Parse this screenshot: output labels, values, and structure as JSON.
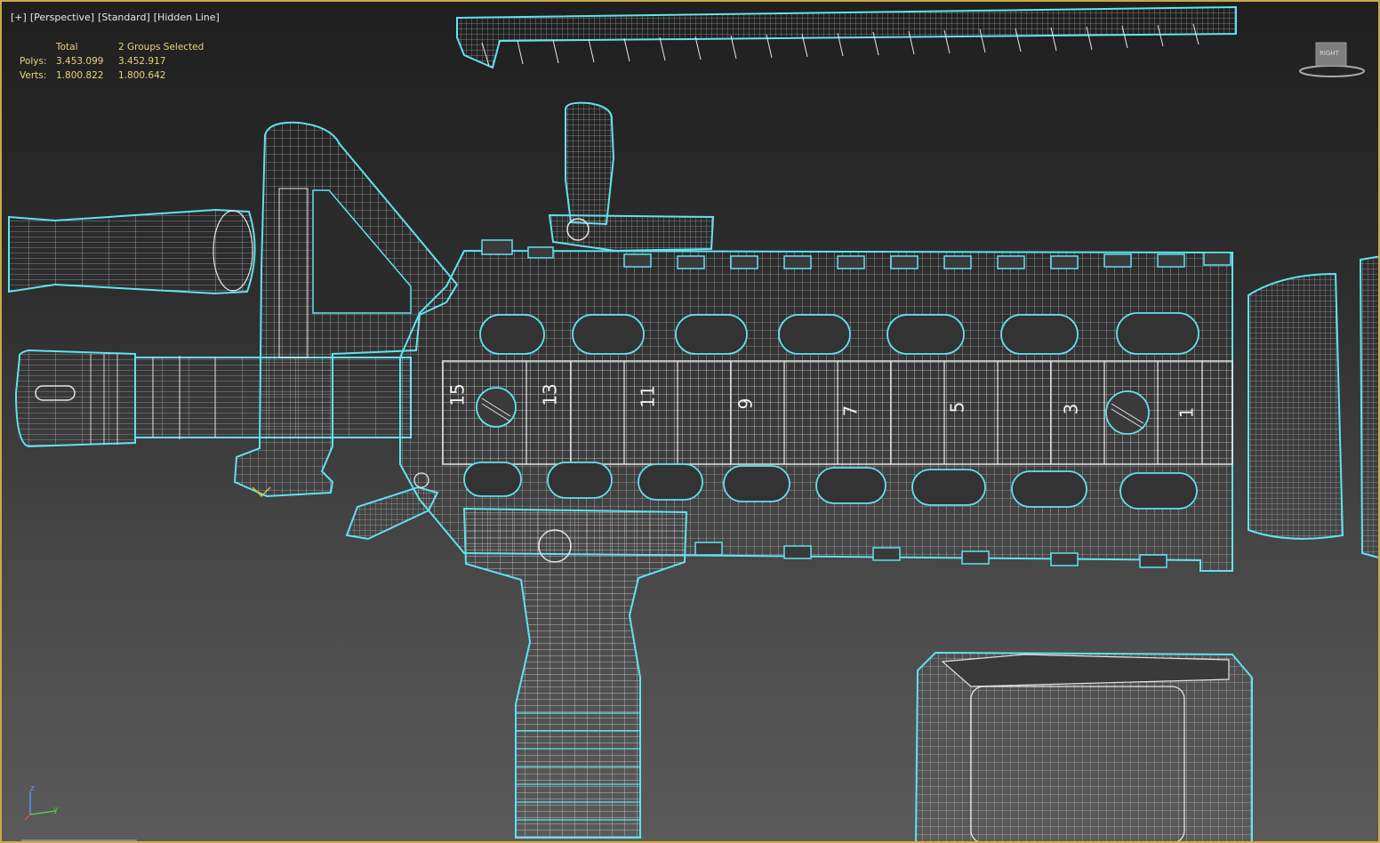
{
  "viewport": {
    "labels": [
      "[+]",
      "[Perspective]",
      "[Standard]",
      "[Hidden Line]"
    ]
  },
  "stats": {
    "headers": [
      "",
      "Total",
      "2 Groups Selected"
    ],
    "rows": [
      {
        "label": "Polys:",
        "total": "3.453.099",
        "selected": "3.452.917"
      },
      {
        "label": "Verts:",
        "total": "1.800.822",
        "selected": "1.800.642"
      }
    ]
  },
  "viewcube": {
    "label": "RIGHT"
  },
  "axis": {
    "z": "z",
    "y": "y"
  },
  "rail_numbers": [
    "15",
    "13",
    "11",
    "9",
    "7",
    "5",
    "3",
    "1"
  ],
  "colors": {
    "selection": "#5fe3ef",
    "wire": "#e6e6e6",
    "border": "#c9a94a",
    "stats_text": "#e8d47a"
  }
}
